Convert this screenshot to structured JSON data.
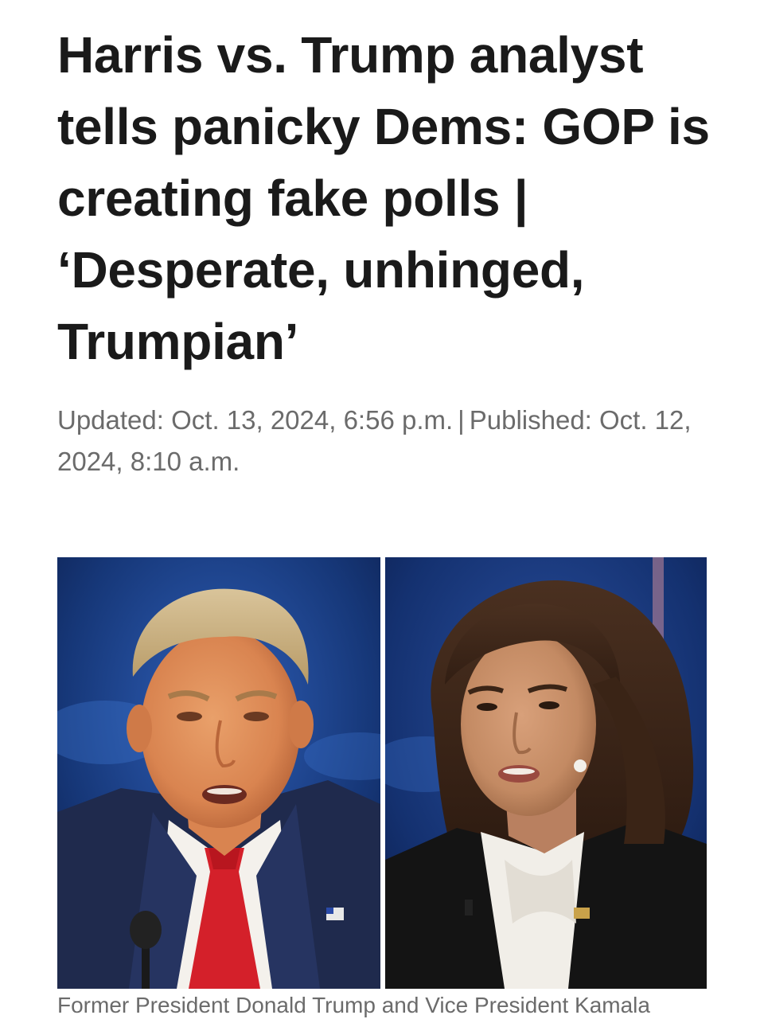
{
  "article": {
    "headline": "Harris vs. Trump analyst tells panicky Dems: GOP is creating fake polls | ‘Desperate, unhinged, Trumpian’",
    "updated": "Updated: Oct. 13, 2024, 6:56 p.m.",
    "separator": "|",
    "published": "Published: Oct. 12, 2024, 8:10 a.m.",
    "caption": "Former President Donald Trump and Vice President Kamala"
  },
  "colors": {
    "headline": "#1a1a1a",
    "meta": "#6b6b6b",
    "stage_blue": "#1b3f8a",
    "tie_red": "#d4202a",
    "suit_navy": "#1f2a4d",
    "jacket_black": "#141414"
  }
}
